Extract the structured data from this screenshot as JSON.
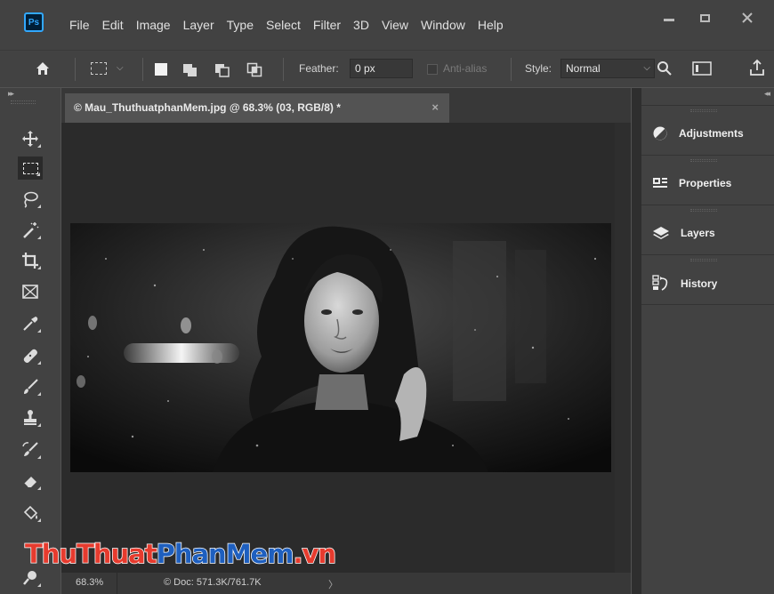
{
  "app": {
    "logo": "Ps"
  },
  "menu": [
    "File",
    "Edit",
    "Image",
    "Layer",
    "Type",
    "Select",
    "Filter",
    "3D",
    "View",
    "Window",
    "Help"
  ],
  "window_controls": [
    "minimize",
    "maximize",
    "close"
  ],
  "options_bar": {
    "feather_label": "Feather:",
    "feather_value": "0 px",
    "antialias_label": "Anti-alias",
    "style_label": "Style:",
    "style_value": "Normal"
  },
  "document": {
    "tab_title": "© Mau_ThuthuatphanMem.jpg @ 68.3% (03, RGB/8) *",
    "close_glyph": "×",
    "zoom": "68.3%",
    "doc_info": "© Doc: 571.3K/761.7K",
    "arrow": "〉"
  },
  "tools": [
    "move-tool",
    "rectangular-marquee-tool",
    "lasso-tool",
    "magic-wand-tool",
    "crop-tool",
    "frame-tool",
    "eyedropper-tool",
    "spot-healing-tool",
    "brush-tool",
    "clone-stamp-tool",
    "history-brush-tool",
    "eraser-tool",
    "paint-bucket-tool",
    "dodge-tool"
  ],
  "panels": [
    {
      "label": "Adjustments",
      "icon": "adjustments-icon"
    },
    {
      "label": "Properties",
      "icon": "properties-icon"
    },
    {
      "label": "Layers",
      "icon": "layers-icon"
    },
    {
      "label": "History",
      "icon": "history-icon"
    }
  ],
  "watermark": {
    "part1": "ThuThuat",
    "part2": "PhanMem",
    "part3": ".vn"
  },
  "colors": {
    "accent": "#31a8ff",
    "panel": "#424242",
    "canvas_bg": "#2b2b2b",
    "watermark_red": "#e63b2e",
    "watermark_blue": "#1e5fbf"
  }
}
